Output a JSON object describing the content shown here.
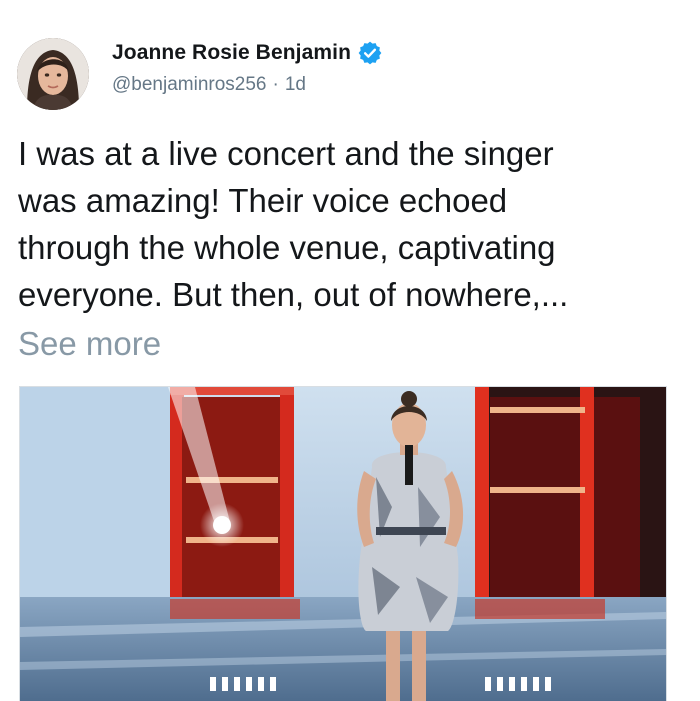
{
  "author": {
    "display_name": "Joanne Rosie Benjamin",
    "handle": "@benjaminros256",
    "time": "1d",
    "separator": "·",
    "verified_icon": "verified-badge-icon",
    "avatar": "profile-photo"
  },
  "tweet": {
    "lines": [
      "I was at a live concert and the singer",
      "was amazing! Their voice echoed",
      "through the whole venue, captivating",
      "everyone. But then, out of nowhere,..."
    ],
    "see_more_label": "See more"
  },
  "media": {
    "description_icon": "concert-photo",
    "colors": {
      "stage_red": "#d42a1e",
      "screen_blue": "#b9d3ea",
      "floor": "#6f8fb0"
    }
  },
  "colors": {
    "text": "#14171a",
    "secondary": "#657786",
    "muted": "#8899a6",
    "verified": "#1da1f2"
  }
}
